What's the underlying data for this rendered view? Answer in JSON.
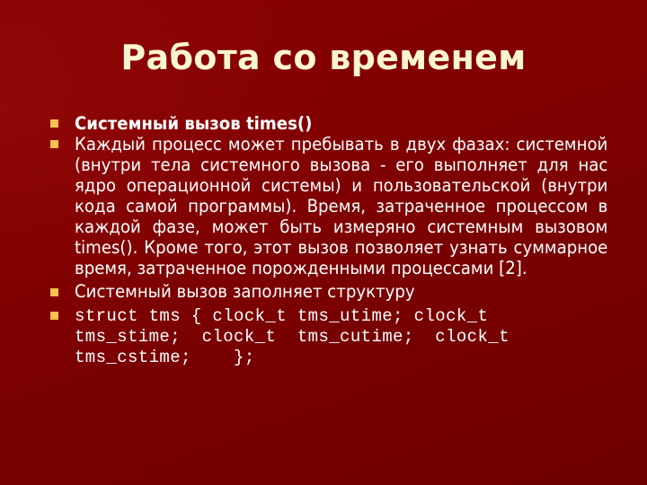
{
  "slide": {
    "title": "Работа со временем",
    "colors": {
      "background": "#7a0000",
      "title_text": "#fcf6d0",
      "body_text": "#ffffff",
      "bullet": "#f8c050"
    },
    "bullets": [
      {
        "text": "Системный вызов times()",
        "style": "bold"
      },
      {
        "text": "Каждый процесс может пребывать в двух фазах: системной (внутри тела системного вызова - его выполняет для нас ядро операционной системы) и пользовательской (внутри кода самой программы). Время, затраченное процессом в каждой фазе, может быть измеряно системным вызовом times(). Кроме того, этот вызов позволяет узнать суммарное время, затраченное порожденными процессами [2].",
        "style": "normal"
      },
      {
        "text": "Системный вызов заполняет структуру",
        "style": "normal"
      },
      {
        "lines": [
          "struct tms { clock_t tms_utime; clock_t",
          "tms_stime;  clock_t  tms_cutime;  clock_t",
          "tms_cstime;    };"
        ],
        "style": "code"
      }
    ]
  }
}
